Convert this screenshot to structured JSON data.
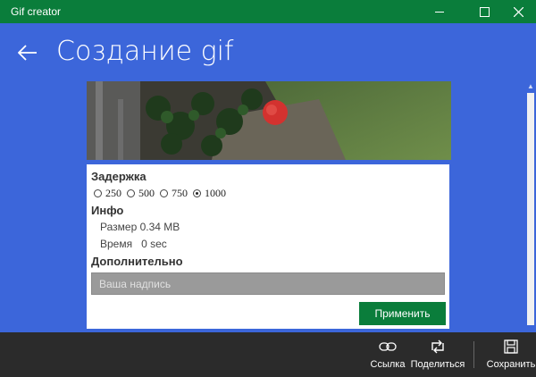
{
  "window": {
    "title": "Gif creator",
    "colors": {
      "titlebar": "#0a7d3b",
      "accent": "#3c66da",
      "command_bar": "#2b2b2b",
      "apply_button": "#0a7d3b"
    }
  },
  "header": {
    "title": "Создание gif"
  },
  "delay": {
    "label": "Задержка",
    "options": [
      "250",
      "500",
      "750",
      "1000"
    ],
    "selected": "1000"
  },
  "info": {
    "label": "Инфо",
    "size_line": "Размер 0.34 MB",
    "time_line": "Время   0 sec"
  },
  "extra": {
    "label": "Дополнительно",
    "caption_placeholder": "Ваша надпись",
    "caption_value": "",
    "apply_label": "Применить"
  },
  "commands": {
    "link": "Ссылка",
    "share": "Поделиться",
    "save": "Сохранить"
  }
}
